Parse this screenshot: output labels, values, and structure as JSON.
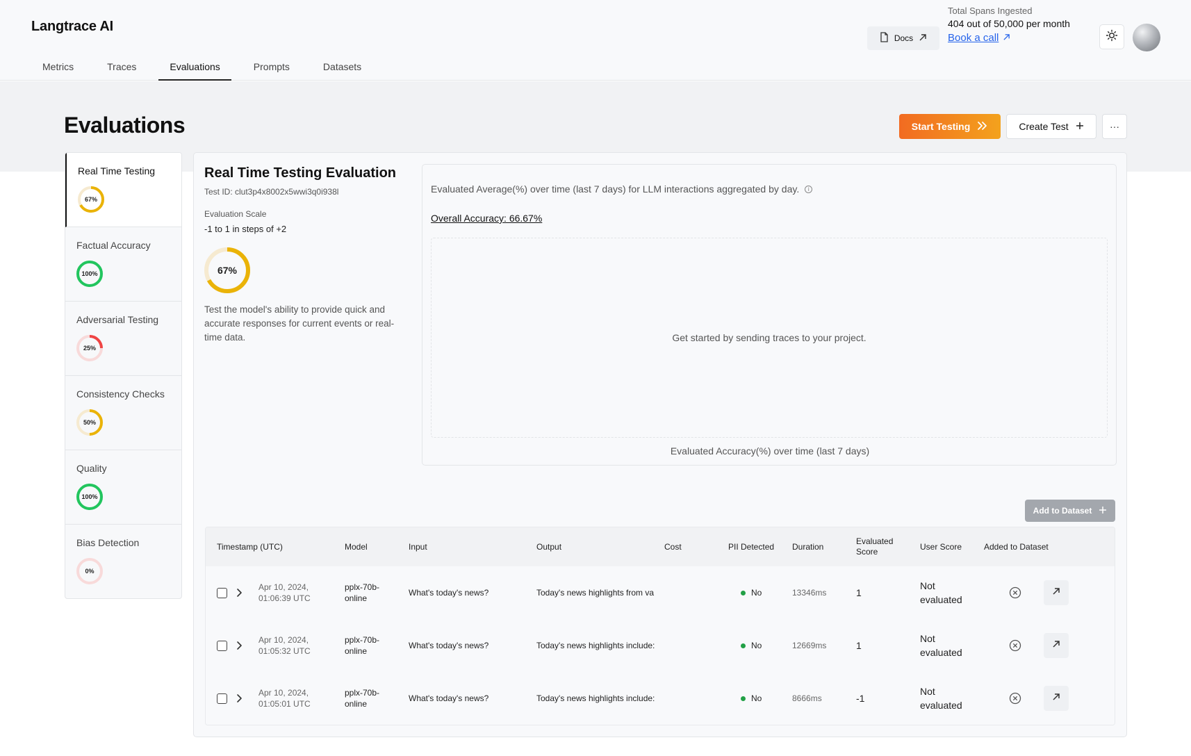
{
  "header": {
    "logo": "Langtrace AI",
    "tabs": [
      "Metrics",
      "Traces",
      "Evaluations",
      "Prompts",
      "Datasets"
    ],
    "active_tab": "Evaluations",
    "docs_label": "Docs",
    "spans_label": "Total Spans Ingested",
    "spans_value": "404 out of 50,000 per month",
    "book_call": "Book a call"
  },
  "page": {
    "title": "Evaluations",
    "start_testing": "Start Testing",
    "create_test": "Create Test",
    "more": "···"
  },
  "sidebar": {
    "items": [
      {
        "name": "Real Time Testing",
        "pct": "67%",
        "value": 67,
        "color": "#eab308",
        "track": "#f6ead0"
      },
      {
        "name": "Factual Accuracy",
        "pct": "100%",
        "value": 100,
        "color": "#22c55e",
        "track": "#dcf3e4"
      },
      {
        "name": "Adversarial Testing",
        "pct": "25%",
        "value": 25,
        "color": "#ef4444",
        "track": "#f8dada"
      },
      {
        "name": "Consistency Checks",
        "pct": "50%",
        "value": 50,
        "color": "#eab308",
        "track": "#f6ead0"
      },
      {
        "name": "Quality",
        "pct": "100%",
        "value": 100,
        "color": "#22c55e",
        "track": "#dcf3e4"
      },
      {
        "name": "Bias Detection",
        "pct": "0%",
        "value": 0,
        "color": "#ef4444",
        "track": "#f8dada"
      }
    ]
  },
  "detail": {
    "title": "Real Time Testing Evaluation",
    "test_id": "Test ID: clut3p4x8002x5wwi3q0i938l",
    "scale_label": "Evaluation Scale",
    "scale_value": "-1 to 1 in steps of +2",
    "pct": "67%",
    "value": 67,
    "description": "Test the model's ability to provide quick and accurate responses for current events or real-time data."
  },
  "chart": {
    "subtitle": "Evaluated Average(%) over time (last 7 days) for LLM interactions aggregated by day.",
    "overall": "Overall Accuracy: 66.67%",
    "empty": "Get started by sending traces to your project.",
    "caption": "Evaluated Accuracy(%) over time (last 7 days)"
  },
  "table": {
    "add_to_dataset": "Add to Dataset",
    "headers": [
      "Timestamp (UTC)",
      "Model",
      "Input",
      "Output",
      "Cost",
      "PII Detected",
      "Duration",
      "Evaluated Score",
      "User Score",
      "Added to Dataset"
    ],
    "rows": [
      {
        "ts1": "Apr 10, 2024,",
        "ts2": "01:06:39 UTC",
        "model1": "pplx-70b-",
        "model2": "online",
        "input": "What's today's news?",
        "output": "Today's news highlights from va",
        "cost": "",
        "pii": "No",
        "duration": "13346ms",
        "score": "1",
        "user1": "Not",
        "user2": "evaluated"
      },
      {
        "ts1": "Apr 10, 2024,",
        "ts2": "01:05:32 UTC",
        "model1": "pplx-70b-",
        "model2": "online",
        "input": "What's today's news?",
        "output": "Today's news highlights include:",
        "cost": "",
        "pii": "No",
        "duration": "12669ms",
        "score": "1",
        "user1": "Not",
        "user2": "evaluated"
      },
      {
        "ts1": "Apr 10, 2024,",
        "ts2": "01:05:01 UTC",
        "model1": "pplx-70b-",
        "model2": "online",
        "input": "What's today's news?",
        "output": "Today's news highlights include:",
        "cost": "",
        "pii": "No",
        "duration": "8666ms",
        "score": "-1",
        "user1": "Not",
        "user2": "evaluated"
      }
    ]
  }
}
